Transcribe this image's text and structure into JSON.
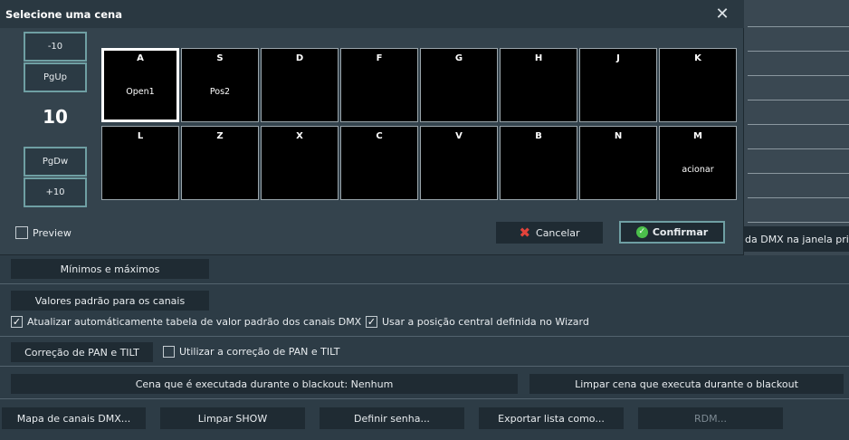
{
  "dialog": {
    "title": "Selecione uma cena",
    "close_glyph": "✕",
    "nav": {
      "minus10": "-10",
      "pgup": "PgUp",
      "page_number": "10",
      "pgdw": "PgDw",
      "plus10": "+10"
    },
    "scenes": [
      {
        "key": "A",
        "name": "Open1",
        "selected": true
      },
      {
        "key": "S",
        "name": "Pos2"
      },
      {
        "key": "D",
        "name": ""
      },
      {
        "key": "F",
        "name": ""
      },
      {
        "key": "G",
        "name": ""
      },
      {
        "key": "H",
        "name": ""
      },
      {
        "key": "J",
        "name": ""
      },
      {
        "key": "K",
        "name": ""
      },
      {
        "key": "L",
        "name": ""
      },
      {
        "key": "Z",
        "name": ""
      },
      {
        "key": "X",
        "name": ""
      },
      {
        "key": "C",
        "name": ""
      },
      {
        "key": "V",
        "name": ""
      },
      {
        "key": "B",
        "name": ""
      },
      {
        "key": "N",
        "name": ""
      },
      {
        "key": "M",
        "name": "acionar"
      }
    ],
    "preview_label": "Preview",
    "preview_checked": false,
    "cancel_label": "Cancelar",
    "confirm_label": "Confirmar",
    "cancel_icon": "x-icon",
    "confirm_icon": "check-circle-icon"
  },
  "background": {
    "partial_text": "da DMX na janela princ",
    "minmax_label": "Mínimos e máximos",
    "default_values_label": "Valores padrão para os canais",
    "auto_update_label": "Atualizar automáticamente tabela de valor padrão dos canais DMX",
    "auto_update_checked": true,
    "center_position_label": "Usar a posição central definida no Wizard",
    "center_position_checked": true,
    "pan_tilt_btn_label": "Correção de PAN e TILT",
    "pan_tilt_use_label": "Utilizar a correção de PAN e TILT",
    "pan_tilt_use_checked": false,
    "blackout_scene_label": "Cena que é executada durante o blackout: Nenhum",
    "clear_blackout_label": "Limpar cena que executa durante o blackout",
    "bottom_buttons": {
      "dmx_map": "Mapa de canais DMX...",
      "clear_show": "Limpar SHOW",
      "set_password": "Definir senha...",
      "export_list": "Exportar lista como...",
      "rdm": "RDM..."
    }
  },
  "colors": {
    "accent_border": "#6f9fa3",
    "cancel_red": "#e2433b",
    "confirm_green": "#4bbf4b"
  }
}
